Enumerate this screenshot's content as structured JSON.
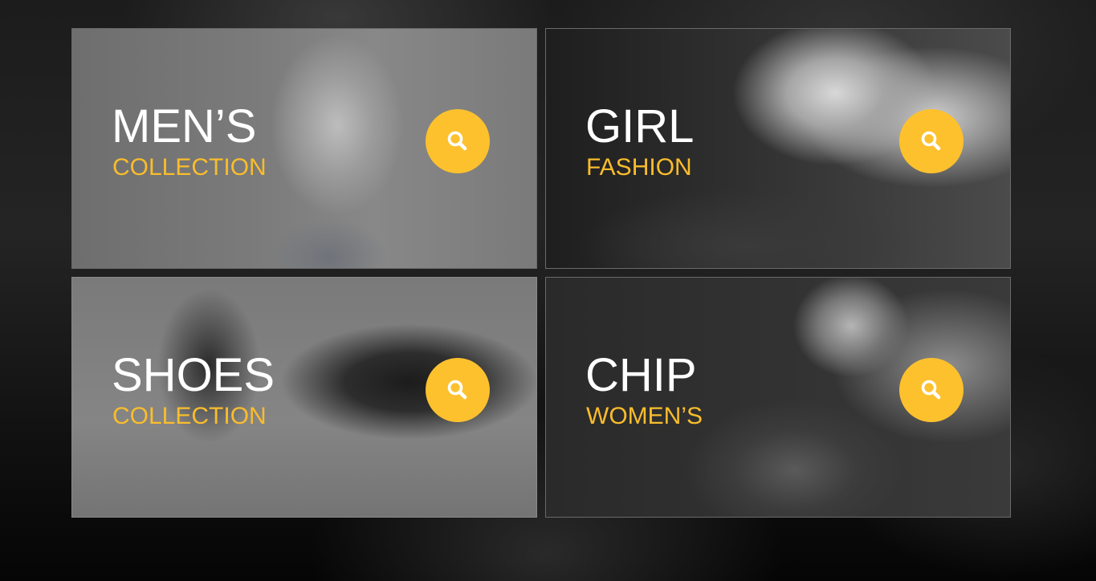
{
  "tiles": [
    {
      "title": "MEN’S",
      "subtitle": "COLLECTION",
      "icon": "search-icon"
    },
    {
      "title": "GIRL",
      "subtitle": "FASHION",
      "icon": "search-icon"
    },
    {
      "title": "SHOES",
      "subtitle": "COLLECTION",
      "icon": "search-icon"
    },
    {
      "title": "CHIP",
      "subtitle": "WOMEN’S",
      "icon": "search-icon"
    }
  ],
  "colors": {
    "accent": "#fdc12e",
    "subtitle": "#f9bd2c",
    "title": "#ffffff"
  }
}
